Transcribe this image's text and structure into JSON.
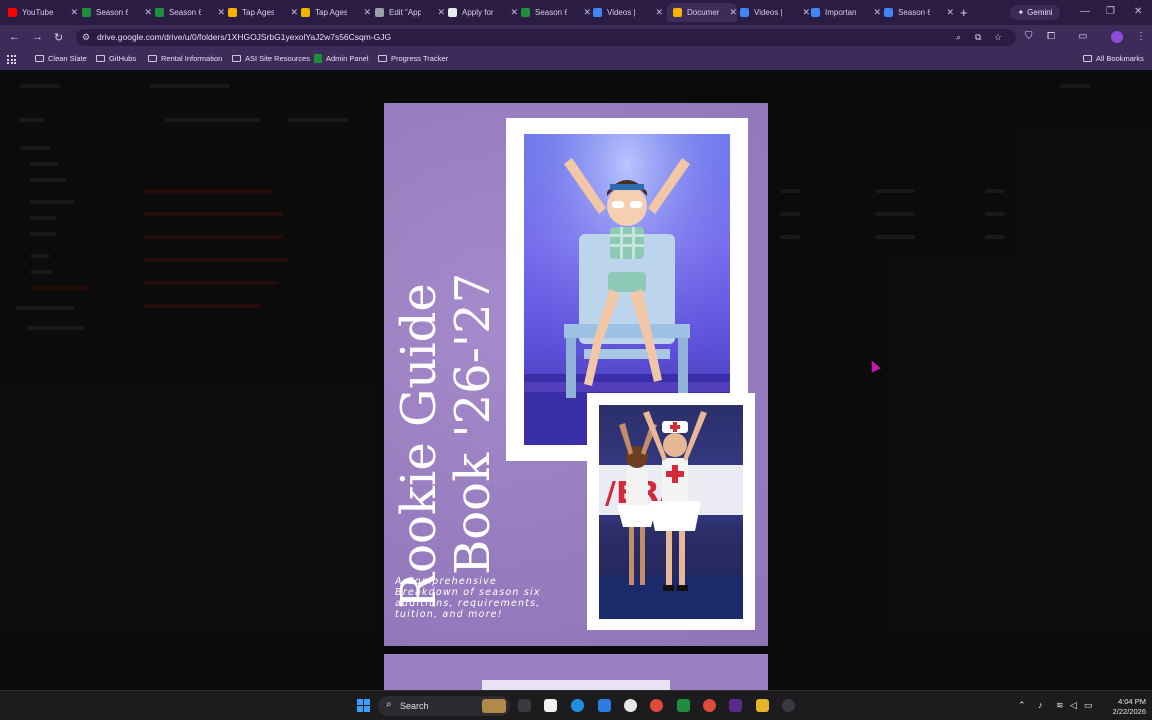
{
  "browser": {
    "tabs": [
      {
        "label": "YouTube",
        "icon": "youtube-icon",
        "color": "#ff0000",
        "active": false
      },
      {
        "label": "Season 6",
        "icon": "sheets-icon",
        "color": "#1e8e3e",
        "active": false
      },
      {
        "label": "Season 6",
        "icon": "sheets-icon",
        "color": "#1e8e3e",
        "active": false
      },
      {
        "label": "Tap Ages",
        "icon": "drive-icon",
        "color": "#f4b400",
        "active": false
      },
      {
        "label": "Tap Ages",
        "icon": "drive-icon",
        "color": "#f4b400",
        "active": false
      },
      {
        "label": "Edit \"App",
        "icon": "globe-icon",
        "color": "#9aa0a6",
        "active": false
      },
      {
        "label": "Apply for",
        "icon": "page-icon",
        "color": "#e8eaed",
        "active": false
      },
      {
        "label": "Season 6",
        "icon": "sheets-icon",
        "color": "#1e8e3e",
        "active": false
      },
      {
        "label": "Videos | ",
        "icon": "site-icon",
        "color": "#4285f4",
        "active": false
      },
      {
        "label": "Documen",
        "icon": "drive-icon",
        "color": "#f4b400",
        "active": true
      },
      {
        "label": "Videos | ",
        "icon": "site-icon",
        "color": "#4285f4",
        "active": false
      },
      {
        "label": "Importan",
        "icon": "site-icon",
        "color": "#4285f4",
        "active": false
      },
      {
        "label": "Season 6",
        "icon": "site-icon",
        "color": "#4285f4",
        "active": false
      }
    ],
    "new_tab": "+",
    "gemini_label": "Gemini",
    "url": "drive.google.com/drive/u/0/folders/1XHGOJSrbG1yexolYaJ2w7s56Csqm-GJG",
    "bookmarks": [
      {
        "label": "Clean Slate",
        "type": "folder"
      },
      {
        "label": "GitHubs",
        "type": "folder"
      },
      {
        "label": "Rental Information",
        "type": "folder"
      },
      {
        "label": "ASI Site Resources",
        "type": "folder"
      },
      {
        "label": "Admin Panel",
        "type": "sheet"
      },
      {
        "label": "Progress Tracker",
        "type": "folder"
      }
    ],
    "all_bookmarks": "All Bookmarks"
  },
  "preview": {
    "title_line1": "Rookie Guide",
    "title_line2": "Book '26-'27",
    "subtitle": "A Comprehensive Breakdown of season six auditions, requirements, tuition, and more!",
    "accent_color": "#9a7fc2"
  },
  "taskbar": {
    "search_label": "Search",
    "time": "4:04 PM",
    "date": "2/22/2026"
  }
}
